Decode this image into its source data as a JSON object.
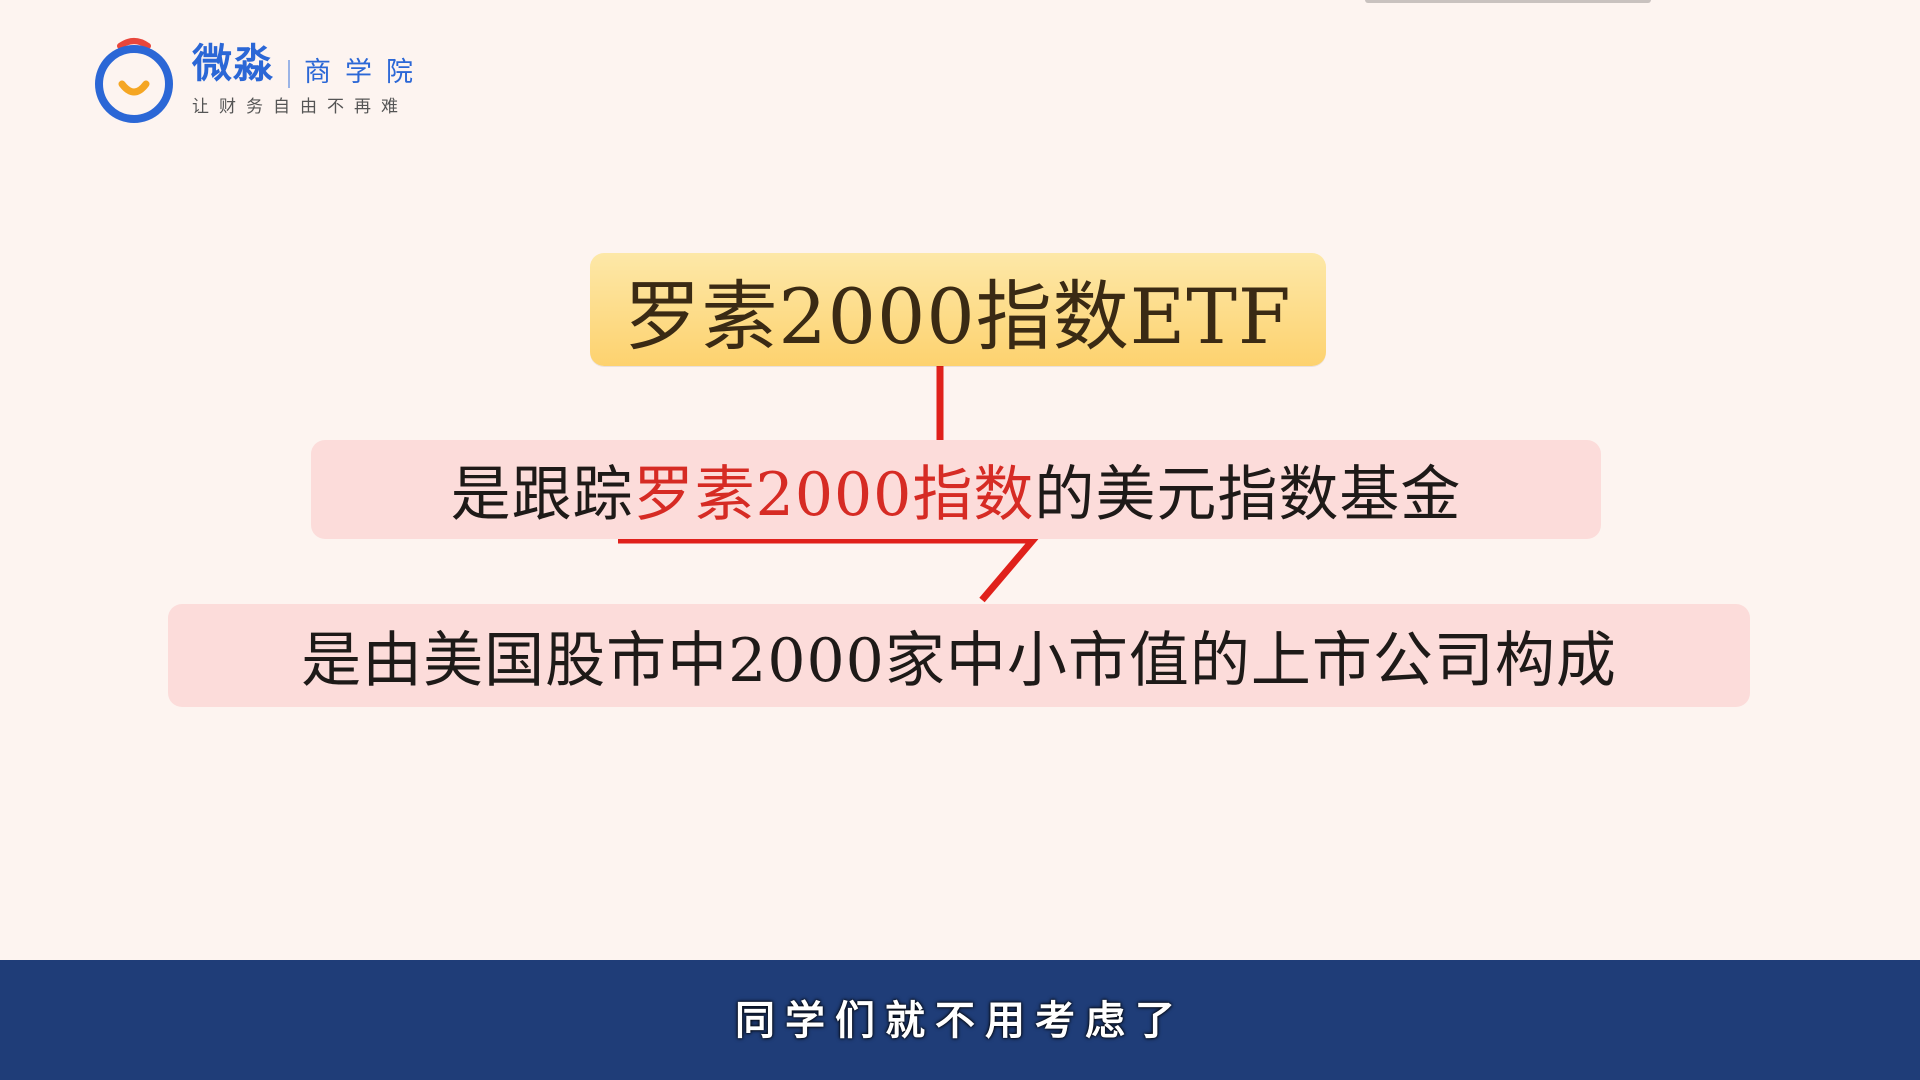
{
  "logo": {
    "name": "微淼",
    "sub": "商学院",
    "tagline": "让财务自由不再难",
    "ring_color": "#2b67d6",
    "arc_color": "#e8463b",
    "smile_color": "#f5a623"
  },
  "title": "罗素2000指数ETF",
  "line1": {
    "prefix": "是跟踪",
    "highlight": "罗素2000指数",
    "suffix": "的美元指数基金"
  },
  "line2": "是由美国股市中2000家中小市值的上市公司构成",
  "subtitle": "同学们就不用考虑了",
  "colors": {
    "background": "#fdf4f0",
    "title_box": "#fdd26f",
    "content_box": "#fcdcda",
    "connector": "#e0211b",
    "highlight": "#d62b24",
    "subtitle_bar": "#1f3d78"
  }
}
